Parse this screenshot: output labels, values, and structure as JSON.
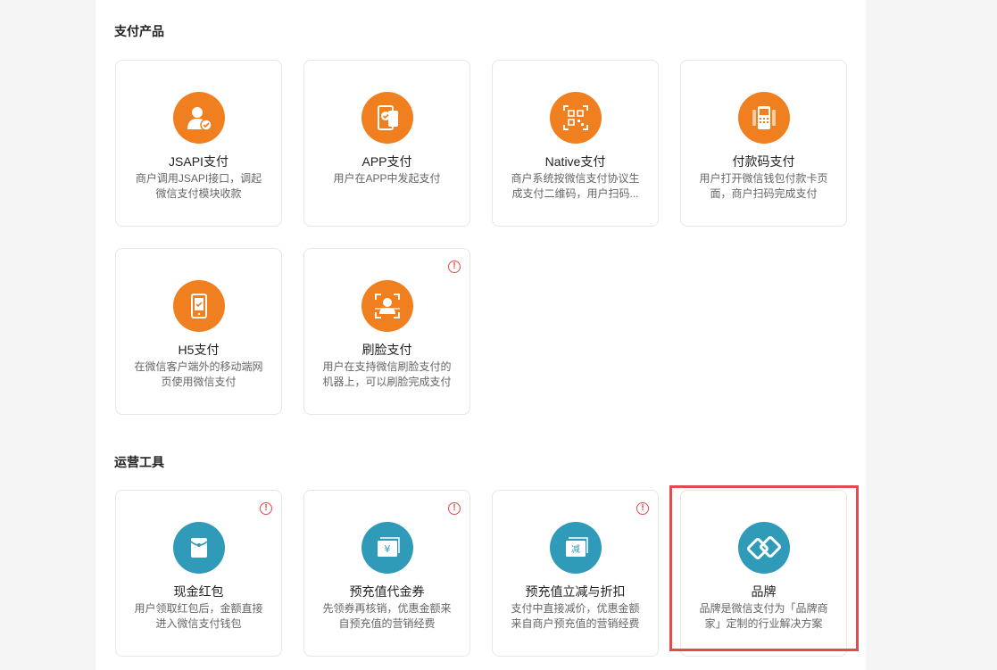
{
  "sections": {
    "payment": {
      "title": "支付产品"
    },
    "operations": {
      "title": "运营工具"
    }
  },
  "cards": [
    {
      "name": "JSAPI支付",
      "desc": "商户调用JSAPI接口，调起微信支付模块收款",
      "icon": "user-check-icon",
      "color": "#f07f1f"
    },
    {
      "name": "APP支付",
      "desc": "用户在APP中发起支付",
      "icon": "phone-pay-icon",
      "color": "#f07f1f"
    },
    {
      "name": "Native支付",
      "desc": "商户系统按微信支付协议生成支付二维码，用户扫码...",
      "icon": "qrcode-icon",
      "color": "#f07f1f"
    },
    {
      "name": "付款码支付",
      "desc": "用户打开微信钱包付款卡页面，商户扫码完成支付",
      "icon": "barcode-scanner-icon",
      "color": "#f07f1f"
    },
    {
      "name": "H5支付",
      "desc": "在微信客户端外的移动端网页使用微信支付",
      "icon": "mobile-check-icon",
      "color": "#f07f1f"
    },
    {
      "name": "刷脸支付",
      "desc": "用户在支持微信刷脸支付的机器上，可以刷脸完成支付",
      "icon": "face-scan-icon",
      "color": "#f07f1f",
      "warning": "!"
    },
    {
      "name": "现金红包",
      "desc": "用户领取红包后，金额直接进入微信支付钱包",
      "icon": "red-envelope-icon",
      "color": "#2f9bb8",
      "warning": "!"
    },
    {
      "name": "预充值代金券",
      "desc": "先领券再核销，优惠金额来自预充值的营销经费",
      "icon": "voucher-yen-icon",
      "color": "#2f9bb8",
      "warning": "!"
    },
    {
      "name": "预充值立减与折扣",
      "desc": "支付中直接减价，优惠金额来自商户预充值的营销经费",
      "icon": "discount-ticket-icon",
      "color": "#2f9bb8",
      "warning": "!",
      "glyph": "减"
    },
    {
      "name": "品牌",
      "desc": "品牌是微信支付为「品牌商家」定制的行业解决方案",
      "icon": "brand-logo-icon",
      "color": "#2f9bb8"
    }
  ],
  "colors": {
    "accent_orange": "#f07f1f",
    "accent_teal": "#2f9bb8",
    "highlight": "#e04b4b",
    "warning": "#e24b4b"
  }
}
